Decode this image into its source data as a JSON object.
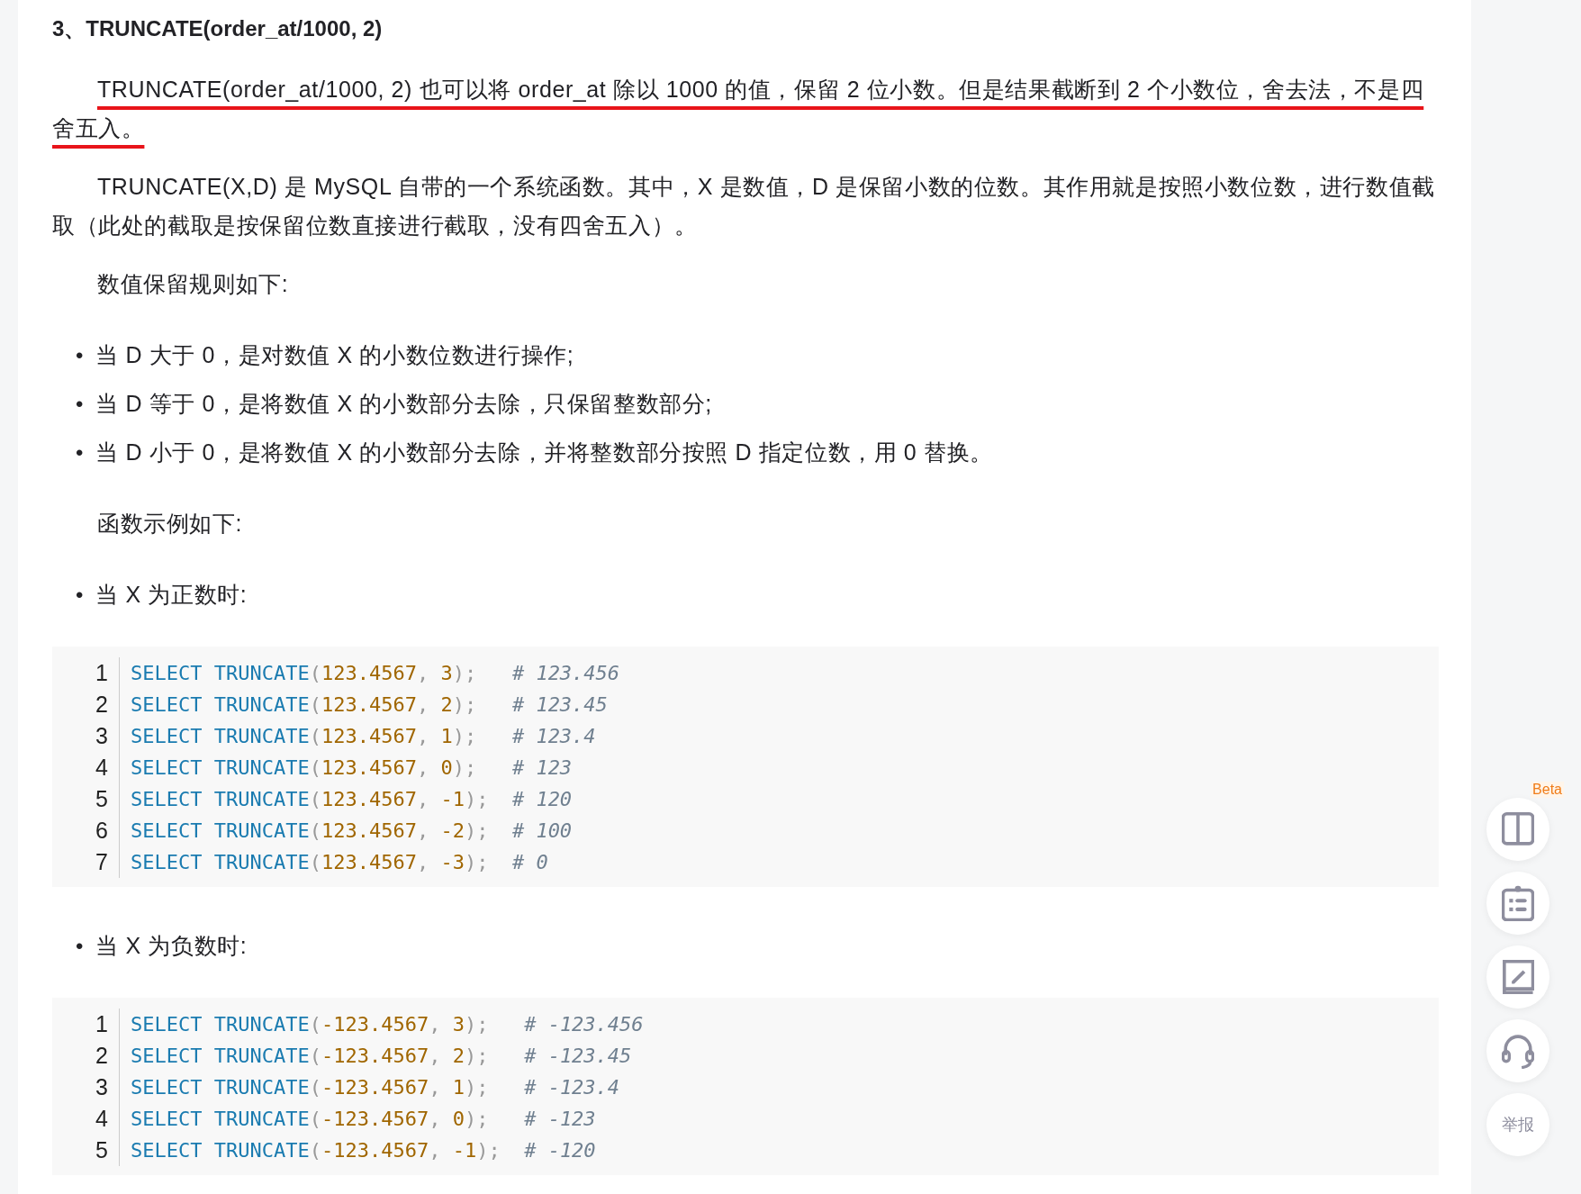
{
  "heading": "3、TRUNCATE(order_at/1000, 2)",
  "blocks": [
    {
      "kind": "paragraph",
      "text": "TRUNCATE(order_at/1000, 2) 也可以将 order_at 除以 1000 的值，保留 2 位小数。但是结果截断到 2 个小数位，舍去法，不是四舍五入。",
      "underlined": true
    },
    {
      "kind": "paragraph",
      "text": "TRUNCATE(X,D) 是 MySQL 自带的一个系统函数。其中，X 是数值，D 是保留小数的位数。其作用就是按照小数位数，进行数值截取（此处的截取是按保留位数直接进行截取，没有四舍五入）。",
      "underlined": false
    },
    {
      "kind": "paragraph",
      "text": "数值保留规则如下:",
      "underlined": false
    },
    {
      "kind": "bullets",
      "items": [
        {
          "marker": "•",
          "text": "当 D 大于 0，是对数值 X 的小数位数进行操作;"
        },
        {
          "marker": "•",
          "text": "当 D 等于 0，是将数值 X 的小数部分去除，只保留整数部分;"
        },
        {
          "marker": "•",
          "text": "当 D 小于 0，是将数值 X 的小数部分去除，并将整数部分按照 D 指定位数，用 0 替换。"
        }
      ]
    },
    {
      "kind": "paragraph",
      "text": "函数示例如下:",
      "underlined": false
    },
    {
      "kind": "bullets",
      "items": [
        {
          "marker": "•",
          "text": "当 X 为正数时:"
        }
      ]
    },
    {
      "kind": "code",
      "lines": [
        {
          "number": "1",
          "tokens": [
            {
              "kind": "keyword",
              "text": "SELECT TRUNCATE"
            },
            {
              "kind": "punct",
              "text": "("
            },
            {
              "kind": "number",
              "text": "123.4567"
            },
            {
              "kind": "punct",
              "text": ", "
            },
            {
              "kind": "number",
              "text": "3"
            },
            {
              "kind": "punct",
              "text": ");   "
            },
            {
              "kind": "comment",
              "text": "# 123.456"
            }
          ]
        },
        {
          "number": "2",
          "tokens": [
            {
              "kind": "keyword",
              "text": "SELECT TRUNCATE"
            },
            {
              "kind": "punct",
              "text": "("
            },
            {
              "kind": "number",
              "text": "123.4567"
            },
            {
              "kind": "punct",
              "text": ", "
            },
            {
              "kind": "number",
              "text": "2"
            },
            {
              "kind": "punct",
              "text": ");   "
            },
            {
              "kind": "comment",
              "text": "# 123.45"
            }
          ]
        },
        {
          "number": "3",
          "tokens": [
            {
              "kind": "keyword",
              "text": "SELECT TRUNCATE"
            },
            {
              "kind": "punct",
              "text": "("
            },
            {
              "kind": "number",
              "text": "123.4567"
            },
            {
              "kind": "punct",
              "text": ", "
            },
            {
              "kind": "number",
              "text": "1"
            },
            {
              "kind": "punct",
              "text": ");   "
            },
            {
              "kind": "comment",
              "text": "# 123.4"
            }
          ]
        },
        {
          "number": "4",
          "tokens": [
            {
              "kind": "keyword",
              "text": "SELECT TRUNCATE"
            },
            {
              "kind": "punct",
              "text": "("
            },
            {
              "kind": "number",
              "text": "123.4567"
            },
            {
              "kind": "punct",
              "text": ", "
            },
            {
              "kind": "number",
              "text": "0"
            },
            {
              "kind": "punct",
              "text": ");   "
            },
            {
              "kind": "comment",
              "text": "# 123"
            }
          ]
        },
        {
          "number": "5",
          "tokens": [
            {
              "kind": "keyword",
              "text": "SELECT TRUNCATE"
            },
            {
              "kind": "punct",
              "text": "("
            },
            {
              "kind": "number",
              "text": "123.4567"
            },
            {
              "kind": "punct",
              "text": ", "
            },
            {
              "kind": "number",
              "text": "-1"
            },
            {
              "kind": "punct",
              "text": ");  "
            },
            {
              "kind": "comment",
              "text": "# 120"
            }
          ]
        },
        {
          "number": "6",
          "tokens": [
            {
              "kind": "keyword",
              "text": "SELECT TRUNCATE"
            },
            {
              "kind": "punct",
              "text": "("
            },
            {
              "kind": "number",
              "text": "123.4567"
            },
            {
              "kind": "punct",
              "text": ", "
            },
            {
              "kind": "number",
              "text": "-2"
            },
            {
              "kind": "punct",
              "text": ");  "
            },
            {
              "kind": "comment",
              "text": "# 100"
            }
          ]
        },
        {
          "number": "7",
          "tokens": [
            {
              "kind": "keyword",
              "text": "SELECT TRUNCATE"
            },
            {
              "kind": "punct",
              "text": "("
            },
            {
              "kind": "number",
              "text": "123.4567"
            },
            {
              "kind": "punct",
              "text": ", "
            },
            {
              "kind": "number",
              "text": "-3"
            },
            {
              "kind": "punct",
              "text": ");  "
            },
            {
              "kind": "comment",
              "text": "# 0"
            }
          ]
        }
      ]
    },
    {
      "kind": "bullets",
      "items": [
        {
          "marker": "•",
          "text": "当 X 为负数时:"
        }
      ]
    },
    {
      "kind": "code",
      "lines": [
        {
          "number": "1",
          "tokens": [
            {
              "kind": "keyword",
              "text": "SELECT TRUNCATE"
            },
            {
              "kind": "punct",
              "text": "("
            },
            {
              "kind": "number",
              "text": "-123.4567"
            },
            {
              "kind": "punct",
              "text": ", "
            },
            {
              "kind": "number",
              "text": "3"
            },
            {
              "kind": "punct",
              "text": ");   "
            },
            {
              "kind": "comment",
              "text": "# -123.456"
            }
          ]
        },
        {
          "number": "2",
          "tokens": [
            {
              "kind": "keyword",
              "text": "SELECT TRUNCATE"
            },
            {
              "kind": "punct",
              "text": "("
            },
            {
              "kind": "number",
              "text": "-123.4567"
            },
            {
              "kind": "punct",
              "text": ", "
            },
            {
              "kind": "number",
              "text": "2"
            },
            {
              "kind": "punct",
              "text": ");   "
            },
            {
              "kind": "comment",
              "text": "# -123.45"
            }
          ]
        },
        {
          "number": "3",
          "tokens": [
            {
              "kind": "keyword",
              "text": "SELECT TRUNCATE"
            },
            {
              "kind": "punct",
              "text": "("
            },
            {
              "kind": "number",
              "text": "-123.4567"
            },
            {
              "kind": "punct",
              "text": ", "
            },
            {
              "kind": "number",
              "text": "1"
            },
            {
              "kind": "punct",
              "text": ");   "
            },
            {
              "kind": "comment",
              "text": "# -123.4"
            }
          ]
        },
        {
          "number": "4",
          "tokens": [
            {
              "kind": "keyword",
              "text": "SELECT TRUNCATE"
            },
            {
              "kind": "punct",
              "text": "("
            },
            {
              "kind": "number",
              "text": "-123.4567"
            },
            {
              "kind": "punct",
              "text": ", "
            },
            {
              "kind": "number",
              "text": "0"
            },
            {
              "kind": "punct",
              "text": ");   "
            },
            {
              "kind": "comment",
              "text": "# -123"
            }
          ]
        },
        {
          "number": "5",
          "tokens": [
            {
              "kind": "keyword",
              "text": "SELECT TRUNCATE"
            },
            {
              "kind": "punct",
              "text": "("
            },
            {
              "kind": "number",
              "text": "-123.4567"
            },
            {
              "kind": "punct",
              "text": ", "
            },
            {
              "kind": "number",
              "text": "-1"
            },
            {
              "kind": "punct",
              "text": ");  "
            },
            {
              "kind": "comment",
              "text": "# -120"
            }
          ]
        }
      ]
    }
  ],
  "sidebar": {
    "beta_badge": "Beta",
    "buttons": [
      {
        "kind": "panel"
      },
      {
        "kind": "clipboard"
      },
      {
        "kind": "notebook"
      },
      {
        "kind": "headset"
      },
      {
        "kind": "text",
        "label": "举报"
      }
    ]
  }
}
